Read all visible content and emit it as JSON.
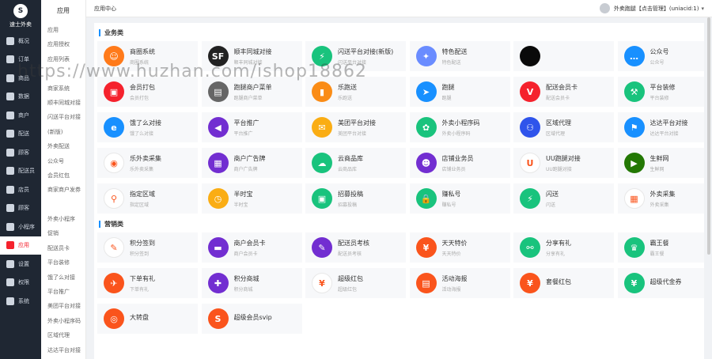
{
  "logo": {
    "mark": "S",
    "name": "速士外卖"
  },
  "nav": [
    {
      "label": "概况"
    },
    {
      "label": "订单"
    },
    {
      "label": "商品"
    },
    {
      "label": "数据"
    },
    {
      "label": "商户"
    },
    {
      "label": "配送"
    },
    {
      "label": "顾客"
    },
    {
      "label": "配送员"
    },
    {
      "label": "店员"
    },
    {
      "label": "顾客"
    },
    {
      "label": "小程序"
    },
    {
      "label": "应用"
    },
    {
      "label": "设置"
    },
    {
      "label": "权限"
    },
    {
      "label": "系统"
    }
  ],
  "nav_active_index": 11,
  "sub": {
    "title": "应用",
    "items": [
      "应用",
      "应用授权",
      "应用列表",
      "",
      "商家系统",
      "顺丰同城对接",
      "闪送平台对接",
      "(新版)",
      "外卖配送",
      "公众号",
      "会员红包",
      "商家商户发券",
      "",
      "外卖小程序",
      "促销",
      "配送员卡",
      "平台装修",
      "饿了么对接",
      "平台推广",
      "美团平台对接",
      "外卖小程序码",
      "区域代理",
      "达达平台对接"
    ]
  },
  "topbar": {
    "breadcrumb": "应用中心",
    "user": "外卖跑腿【点击管理】(uniacid:1)",
    "chev": "▾"
  },
  "sections": [
    {
      "title": "业务类",
      "cards": [
        {
          "title": "商圈系统",
          "desc": "商圈系统",
          "color": "#ff7a1a",
          "glyph": "☺",
          "icon": "merchant-icon"
        },
        {
          "title": "顺丰同城对接",
          "desc": "顺丰同城对接",
          "color": "#222222",
          "glyph": "SF",
          "icon": "sf-logo-icon"
        },
        {
          "title": "闪送平台对接(新版)",
          "desc": "闪送平台对接",
          "color": "#19c37d",
          "glyph": "⚡",
          "icon": "lightning-icon"
        },
        {
          "title": "特色配送",
          "desc": "特色配送",
          "color": "#6a8cff",
          "glyph": "✦",
          "icon": "bird-icon"
        },
        {
          "title": "",
          "desc": "",
          "color": "#0a0a0a",
          "glyph": "",
          "icon": "hidden-icon"
        },
        {
          "title": "公众号",
          "desc": "公众号",
          "color": "#1890ff",
          "glyph": "…",
          "icon": "chat-bubble-icon"
        },
        {
          "title": "会员打包",
          "desc": "会员打包",
          "color": "#f5222d",
          "glyph": "▣",
          "icon": "package-icon"
        },
        {
          "title": "跑腿商户菜单",
          "desc": "跑腿商户菜单",
          "color": "#666666",
          "glyph": "▤",
          "icon": "menu-box-icon"
        },
        {
          "title": "乐跑送",
          "desc": "乐跑送",
          "color": "#fa8c16",
          "glyph": "▮",
          "icon": "phone-icon"
        },
        {
          "title": "跑腿",
          "desc": "跑腿",
          "color": "#1890ff",
          "glyph": "➤",
          "icon": "runner-icon"
        },
        {
          "title": "配送会员卡",
          "desc": "配送会员卡",
          "color": "#f5222d",
          "glyph": "V",
          "icon": "vip-card-icon"
        },
        {
          "title": "平台装修",
          "desc": "平台装修",
          "color": "#19c37d",
          "glyph": "⚒",
          "icon": "hammer-icon"
        },
        {
          "title": "饿了么对接",
          "desc": "饿了么对接",
          "color": "#1890ff",
          "glyph": "e",
          "icon": "eleme-icon"
        },
        {
          "title": "平台推广",
          "desc": "平台推广",
          "color": "#722ed1",
          "glyph": "◀",
          "icon": "megaphone-icon"
        },
        {
          "title": "美团平台对接",
          "desc": "美团平台对接",
          "color": "#faad14",
          "glyph": "✉",
          "icon": "meituan-icon"
        },
        {
          "title": "外卖小程序码",
          "desc": "外卖小程序码",
          "color": "#19c37d",
          "glyph": "✿",
          "icon": "mini-program-icon"
        },
        {
          "title": "区域代理",
          "desc": "区域代理",
          "color": "#2f54eb",
          "glyph": "⚇",
          "icon": "group-icon"
        },
        {
          "title": "达达平台对接",
          "desc": "达达平台对接",
          "color": "#1890ff",
          "glyph": "⚑",
          "icon": "dada-icon"
        },
        {
          "title": "乐外卖采集",
          "desc": "乐外卖采集",
          "color": "#ffffff",
          "glyph": "◉",
          "icon": "collect-logo-icon"
        },
        {
          "title": "商户广告牌",
          "desc": "商户广告牌",
          "color": "#722ed1",
          "glyph": "▦",
          "icon": "store-icon"
        },
        {
          "title": "云商品库",
          "desc": "云商品库",
          "color": "#19c37d",
          "glyph": "☁",
          "icon": "cloud-icon"
        },
        {
          "title": "店铺业务员",
          "desc": "店铺业务员",
          "color": "#722ed1",
          "glyph": "☻",
          "icon": "staff-icon"
        },
        {
          "title": "UU跑腿对接",
          "desc": "UU跑腿对接",
          "color": "#ffffff",
          "glyph": "U",
          "icon": "uu-logo-icon"
        },
        {
          "title": "生鲜网",
          "desc": "生鲜网",
          "color": "#237804",
          "glyph": "▶",
          "icon": "play-icon"
        },
        {
          "title": "指定区域",
          "desc": "指定区域",
          "color": "#ffffff",
          "glyph": "⚲",
          "icon": "location-pin-icon"
        },
        {
          "title": "半时宝",
          "desc": "半时宝",
          "color": "#faad14",
          "glyph": "◷",
          "icon": "clock-icon"
        },
        {
          "title": "招募投稿",
          "desc": "招募投稿",
          "color": "#19c37d",
          "glyph": "▣",
          "icon": "recruit-icon"
        },
        {
          "title": "赚私号",
          "desc": "赚私号",
          "color": "#19c37d",
          "glyph": "🔒",
          "icon": "lock-icon"
        },
        {
          "title": "闪送",
          "desc": "闪送",
          "color": "#19c37d",
          "glyph": "⚡",
          "icon": "flash-icon"
        },
        {
          "title": "外卖采集",
          "desc": "外卖采集",
          "color": "#ffffff",
          "glyph": "▦",
          "icon": "grid-apps-icon"
        }
      ]
    },
    {
      "title": "营销类",
      "cards": [
        {
          "title": "积分签到",
          "desc": "积分签到",
          "color": "#ffffff",
          "glyph": "✎",
          "icon": "sign-in-icon"
        },
        {
          "title": "商户会员卡",
          "desc": "商户会员卡",
          "color": "#722ed1",
          "glyph": "▬",
          "icon": "member-card-icon"
        },
        {
          "title": "配送员考核",
          "desc": "配送员考核",
          "color": "#722ed1",
          "glyph": "✎",
          "icon": "assess-icon"
        },
        {
          "title": "天天特价",
          "desc": "天天特价",
          "color": "#fa541c",
          "glyph": "¥",
          "icon": "discount-icon"
        },
        {
          "title": "分享有礼",
          "desc": "分享有礼",
          "color": "#19c37d",
          "glyph": "⚯",
          "icon": "share-icon"
        },
        {
          "title": "霸王餐",
          "desc": "霸王餐",
          "color": "#19c37d",
          "glyph": "♛",
          "icon": "crown-icon"
        },
        {
          "title": "下单有礼",
          "desc": "下单有礼",
          "color": "#fa541c",
          "glyph": "✈",
          "icon": "order-gift-icon"
        },
        {
          "title": "积分商城",
          "desc": "积分商城",
          "color": "#722ed1",
          "glyph": "✚",
          "icon": "points-mall-icon"
        },
        {
          "title": "超级红包",
          "desc": "超级红包",
          "color": "#ffffff",
          "glyph": "¥",
          "icon": "red-packet-icon"
        },
        {
          "title": "活动海报",
          "desc": "活动海报",
          "color": "#fa541c",
          "glyph": "▤",
          "icon": "poster-icon"
        },
        {
          "title": "套餐红包",
          "desc": "",
          "color": "#fa541c",
          "glyph": "¥",
          "icon": "combo-packet-icon"
        },
        {
          "title": "超级代金券",
          "desc": "",
          "color": "#19c37d",
          "glyph": "¥",
          "icon": "voucher-icon"
        },
        {
          "title": "大转盘",
          "desc": "",
          "color": "#fa541c",
          "glyph": "◎",
          "icon": "wheel-icon"
        },
        {
          "title": "超级会员svip",
          "desc": "",
          "color": "#fa541c",
          "glyph": "S",
          "icon": "svip-icon"
        }
      ]
    }
  ],
  "watermark": "https://www.huzhan.com/ishop18862"
}
